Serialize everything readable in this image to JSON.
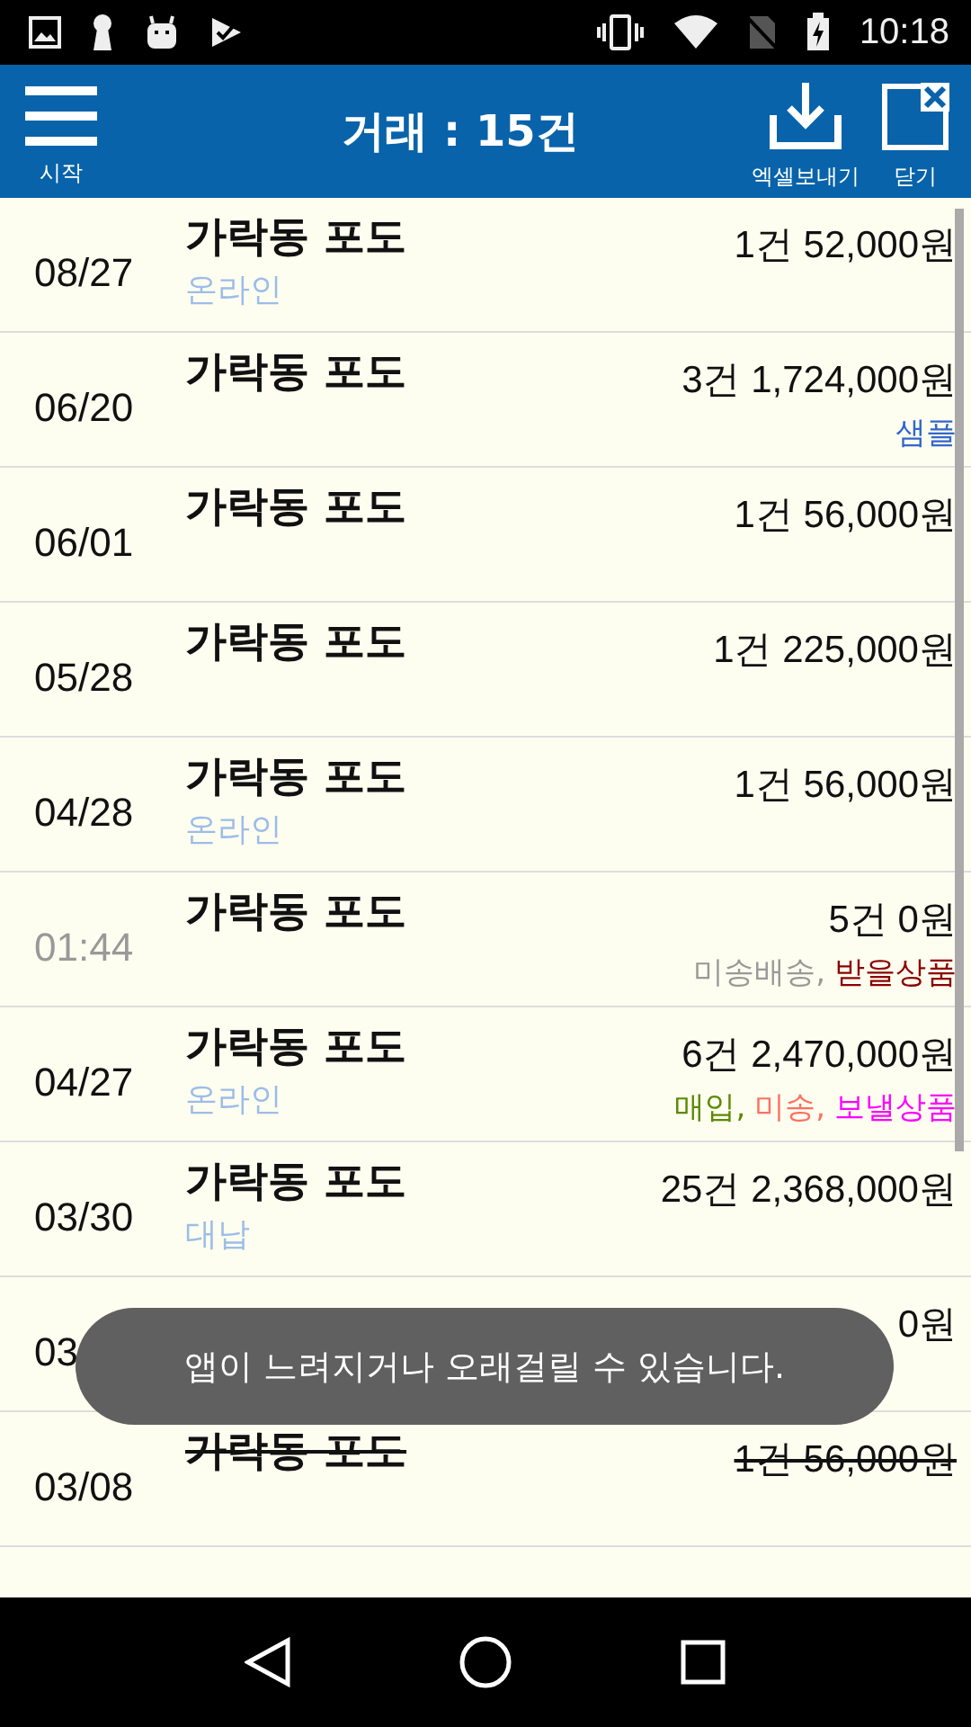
{
  "status_bar": {
    "time": "10:18"
  },
  "header": {
    "menu_label": "시작",
    "title": "거래 : 15건",
    "actions": [
      {
        "kind": "export",
        "label": "엑셀보내기"
      },
      {
        "kind": "close",
        "label": "닫기"
      }
    ]
  },
  "rows": [
    {
      "date": "08/27",
      "dimmed": false,
      "name": "가락동 포도",
      "sub": "온라인",
      "amount": "1건 52,000원",
      "cancelled": false,
      "tags": []
    },
    {
      "date": "06/20",
      "dimmed": false,
      "name": "가락동 포도",
      "amount": "3건 1,724,000원",
      "cancelled": false,
      "tags": [
        {
          "text": "샘플",
          "color": "#3366cc"
        }
      ]
    },
    {
      "date": "06/01",
      "dimmed": false,
      "name": "가락동 포도",
      "amount": "1건 56,000원",
      "cancelled": false,
      "tags": []
    },
    {
      "date": "05/28",
      "dimmed": false,
      "name": "가락동 포도",
      "amount": "1건 225,000원",
      "cancelled": false,
      "tags": []
    },
    {
      "date": "04/28",
      "dimmed": false,
      "name": "가락동 포도",
      "sub": "온라인",
      "amount": "1건 56,000원",
      "cancelled": false,
      "tags": []
    },
    {
      "date": "01:44",
      "dimmed": true,
      "name": "가락동 포도",
      "amount": "5건 0원",
      "cancelled": false,
      "tags": [
        {
          "text": "미송배송,",
          "color": "#999999"
        },
        {
          "text": "받을상품",
          "color": "#8b0000"
        }
      ]
    },
    {
      "date": "04/27",
      "dimmed": false,
      "name": "가락동 포도",
      "sub": "온라인",
      "amount": "6건 2,470,000원",
      "cancelled": false,
      "tags": [
        {
          "text": "매입,",
          "color": "#5a8a00"
        },
        {
          "text": "미송,",
          "color": "#ff7060"
        },
        {
          "text": "보낼상품",
          "color": "#ff00ff"
        }
      ]
    },
    {
      "date": "03/30",
      "dimmed": false,
      "name": "가락동 포도",
      "sub": "대납",
      "amount": "25건 2,368,000원",
      "cancelled": false,
      "tags": []
    },
    {
      "date": "03",
      "dimmed": false,
      "amount": "0원",
      "cancelled": false,
      "tags": []
    },
    {
      "date": "03/08",
      "dimmed": false,
      "name": "가락동 포도",
      "amount": "1건 56,000원",
      "cancelled": true,
      "tags": []
    }
  ],
  "toast": "앱이 느려지거나 오래걸릴 수 있습니다."
}
